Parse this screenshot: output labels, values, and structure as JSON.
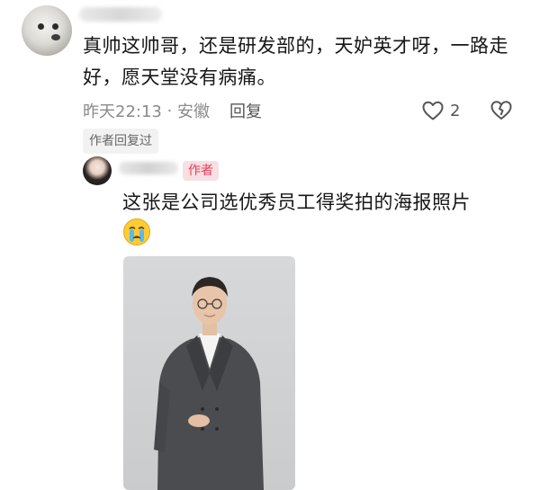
{
  "comment": {
    "text": "真帅这帅哥，还是研发部的，天妒英才呀，一路走好，愿天堂没有病痛。",
    "time": "昨天22:13",
    "location": "安徽",
    "reply_label": "回复",
    "like_count": "2",
    "author_replied_label": "作者回复过"
  },
  "reply": {
    "author_badge": "作者",
    "text": "这张是公司选优秀员工得奖拍的海报照片"
  },
  "icons": {
    "like": "heart-outline-icon",
    "dislike": "broken-heart-icon",
    "emoji": "crying-face-emoji"
  },
  "colors": {
    "badge_text": "#e43f5a",
    "badge_bg": "#f7dfe3",
    "meta_text": "#8a8a8a"
  }
}
